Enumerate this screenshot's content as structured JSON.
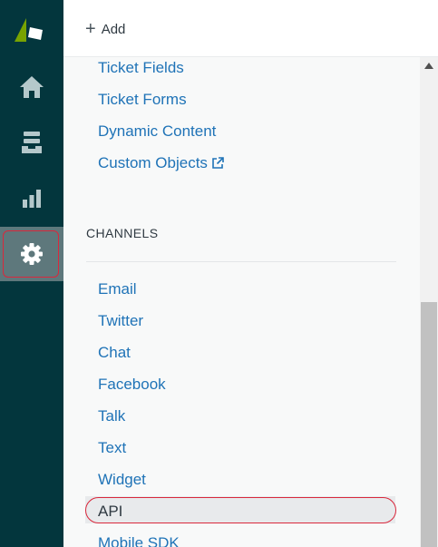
{
  "sidebar": {
    "logo_icon": "zendesk-logo",
    "items": [
      {
        "icon": "home-icon"
      },
      {
        "icon": "views-icon"
      },
      {
        "icon": "reporting-icon"
      },
      {
        "icon": "gear-icon",
        "active": true
      }
    ]
  },
  "topbar": {
    "add_label": "Add"
  },
  "links_top": [
    "Ticket Fields",
    "Ticket Forms",
    "Dynamic Content",
    "Custom Objects"
  ],
  "section": {
    "title": "CHANNELS",
    "items": [
      "Email",
      "Twitter",
      "Chat",
      "Facebook",
      "Talk",
      "Text",
      "Widget",
      "API",
      "Mobile SDK"
    ],
    "selected": "API"
  },
  "colors": {
    "sidebar_bg": "#03363d",
    "active_bg": "#5e787c",
    "link": "#1f73b7",
    "highlight": "#d9283c"
  }
}
